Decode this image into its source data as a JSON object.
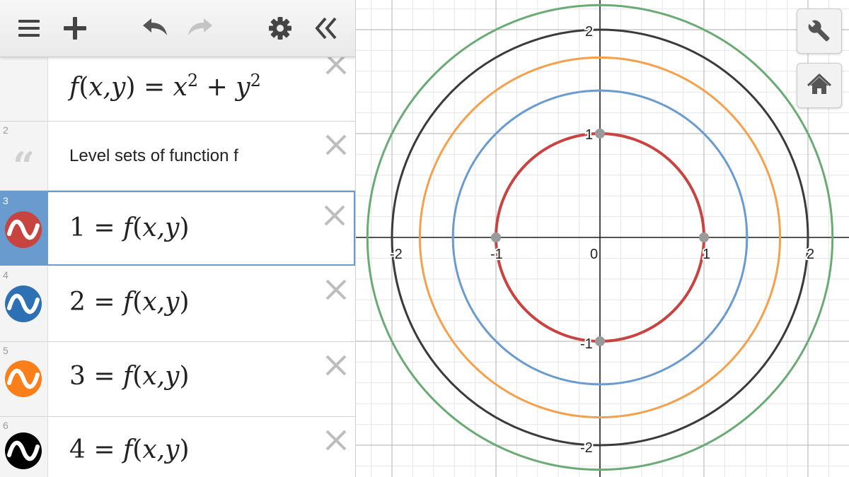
{
  "toolbar": {
    "icons": [
      "menu-icon",
      "add-icon",
      "undo-icon",
      "redo-icon",
      "settings-icon",
      "collapse-panel-icon"
    ]
  },
  "expressions": [
    {
      "index": "",
      "kind": "definition",
      "latex_parts": {
        "f": "f",
        "open": "(",
        "args": "x,y",
        "close": ")",
        "eq": " = ",
        "x": "x",
        "sup1": "2",
        "plus": " + ",
        "y": "y",
        "sup2": "2"
      }
    },
    {
      "index": "2",
      "kind": "note",
      "text": "Level sets of function f"
    },
    {
      "index": "3",
      "kind": "level",
      "value": "1",
      "color": "#c74440",
      "rhs": "f",
      "args": "x,y"
    },
    {
      "index": "4",
      "kind": "level",
      "value": "2",
      "color": "#2d70b3",
      "rhs": "f",
      "args": "x,y"
    },
    {
      "index": "5",
      "kind": "level",
      "value": "3",
      "color": "#fa7e19",
      "rhs": "f",
      "args": "x,y"
    },
    {
      "index": "6",
      "kind": "level",
      "value": "4",
      "color": "#000000",
      "rhs": "f",
      "args": "x,y"
    }
  ],
  "graph": {
    "x_tick_labels": [
      "-2",
      "-1",
      "0",
      "1",
      "2"
    ],
    "y_tick_labels": [
      "2",
      "1",
      "-1",
      "-2"
    ],
    "curves": [
      {
        "level": 1,
        "radius": 1.0,
        "color": "#c74440"
      },
      {
        "level": 2,
        "radius": 1.414,
        "color": "#6a9bcf"
      },
      {
        "level": 3,
        "radius": 1.732,
        "color": "#f5a04c"
      },
      {
        "level": 4,
        "radius": 2.0,
        "color": "#3a3a3a"
      },
      {
        "level": 5,
        "radius": 2.236,
        "color": "#6aaa74"
      }
    ],
    "points": [
      [
        1,
        0
      ],
      [
        -1,
        0
      ],
      [
        0,
        1
      ],
      [
        0,
        -1
      ]
    ]
  },
  "side_buttons": [
    "wrench-icon",
    "home-icon"
  ]
}
